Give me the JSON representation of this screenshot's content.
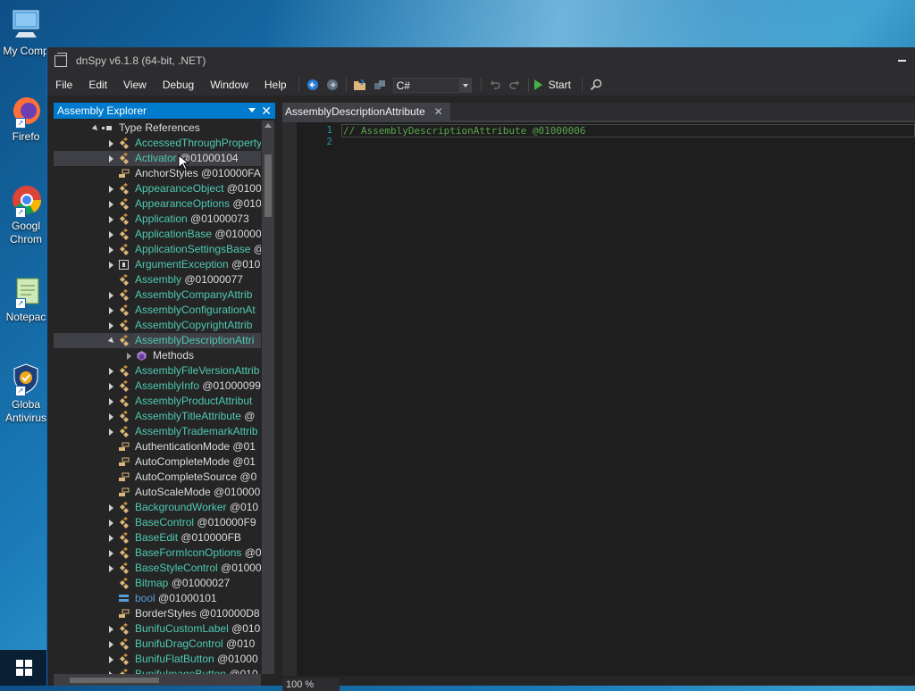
{
  "desktop": {
    "icons": [
      {
        "label": "My Comp",
        "icon": "computer-icon"
      },
      {
        "label": "Firefo",
        "icon": "firefox-icon"
      },
      {
        "label": "Googl\nChrom",
        "icon": "chrome-icon"
      },
      {
        "label": "Notepac",
        "icon": "notepad-icon"
      },
      {
        "label": "Globa\nAntivirus",
        "icon": "antivirus-icon"
      }
    ]
  },
  "window": {
    "title": "dnSpy v6.1.8 (64-bit, .NET)"
  },
  "menu": [
    "File",
    "Edit",
    "View",
    "Debug",
    "Window",
    "Help"
  ],
  "toolbar": {
    "language": "C#",
    "start_label": "Start"
  },
  "explorer": {
    "title": "Assembly Explorer",
    "items": [
      {
        "text": "Type References",
        "kind": "refs",
        "level": 0,
        "expand": "open"
      },
      {
        "text": "AccessedThroughProperty",
        "kind": "class",
        "level": 1,
        "expand": "closed"
      },
      {
        "text": "Activator",
        "suffix": " @01000104",
        "kind": "class",
        "level": 1,
        "expand": "closed",
        "selected": true
      },
      {
        "text": "AnchorStyles @010000FA",
        "kind": "enum",
        "level": 1,
        "expand": "none"
      },
      {
        "text": "AppearanceObject",
        "suffix": " @0100",
        "kind": "class",
        "level": 1,
        "expand": "closed"
      },
      {
        "text": "AppearanceOptions",
        "suffix": " @010",
        "kind": "class",
        "level": 1,
        "expand": "closed"
      },
      {
        "text": "Application",
        "suffix": " @01000073",
        "kind": "class",
        "level": 1,
        "expand": "closed"
      },
      {
        "text": "ApplicationBase",
        "suffix": " @010000",
        "kind": "class",
        "level": 1,
        "expand": "closed"
      },
      {
        "text": "ApplicationSettingsBase",
        "suffix": " @",
        "kind": "class",
        "level": 1,
        "expand": "closed"
      },
      {
        "text": "ArgumentException",
        "suffix": " @010",
        "kind": "exception",
        "level": 1,
        "expand": "closed"
      },
      {
        "text": "Assembly",
        "suffix": " @01000077",
        "kind": "class",
        "level": 1,
        "expand": "none"
      },
      {
        "text": "AssemblyCompanyAttrib",
        "kind": "class",
        "level": 1,
        "expand": "closed"
      },
      {
        "text": "AssemblyConfigurationAt",
        "kind": "class",
        "level": 1,
        "expand": "closed"
      },
      {
        "text": "AssemblyCopyrightAttrib",
        "kind": "class",
        "level": 1,
        "expand": "closed"
      },
      {
        "text": "AssemblyDescriptionAttri",
        "kind": "class",
        "level": 1,
        "expand": "open",
        "selected": true
      },
      {
        "text": "Methods",
        "kind": "methods",
        "level": 2,
        "expand": "hollow"
      },
      {
        "text": "AssemblyFileVersionAttrib",
        "kind": "class",
        "level": 1,
        "expand": "closed"
      },
      {
        "text": "AssemblyInfo",
        "suffix": " @01000099",
        "kind": "class",
        "level": 1,
        "expand": "closed"
      },
      {
        "text": "AssemblyProductAttribut",
        "kind": "class",
        "level": 1,
        "expand": "closed"
      },
      {
        "text": "AssemblyTitleAttribute",
        "suffix": " @",
        "kind": "class",
        "level": 1,
        "expand": "closed"
      },
      {
        "text": "AssemblyTrademarkAttrib",
        "kind": "class",
        "level": 1,
        "expand": "closed"
      },
      {
        "text": "AuthenticationMode @01",
        "kind": "enum",
        "level": 1,
        "expand": "none"
      },
      {
        "text": "AutoCompleteMode @01",
        "kind": "enum",
        "level": 1,
        "expand": "none"
      },
      {
        "text": "AutoCompleteSource @0",
        "kind": "enum",
        "level": 1,
        "expand": "none"
      },
      {
        "text": "AutoScaleMode @010000",
        "kind": "enum",
        "level": 1,
        "expand": "none"
      },
      {
        "text": "BackgroundWorker",
        "suffix": " @010",
        "kind": "class",
        "level": 1,
        "expand": "closed"
      },
      {
        "text": "BaseControl",
        "suffix": " @010000F9",
        "kind": "class",
        "level": 1,
        "expand": "closed"
      },
      {
        "text": "BaseEdit",
        "suffix": " @010000FB",
        "kind": "class",
        "level": 1,
        "expand": "closed"
      },
      {
        "text": "BaseFormIconOptions",
        "suffix": " @0",
        "kind": "class",
        "level": 1,
        "expand": "closed"
      },
      {
        "text": "BaseStyleControl",
        "suffix": " @01000",
        "kind": "class",
        "level": 1,
        "expand": "closed"
      },
      {
        "text": "Bitmap",
        "suffix": " @01000027",
        "kind": "class",
        "level": 1,
        "expand": "none"
      },
      {
        "text": "bool",
        "suffix": " @01000101",
        "kind": "struct",
        "level": 1,
        "expand": "none"
      },
      {
        "text": "BorderStyles @010000D8",
        "kind": "enum",
        "level": 1,
        "expand": "none"
      },
      {
        "text": "BunifuCustomLabel",
        "suffix": " @010",
        "kind": "class",
        "level": 1,
        "expand": "closed"
      },
      {
        "text": "BunifuDragControl",
        "suffix": " @010",
        "kind": "class",
        "level": 1,
        "expand": "closed"
      },
      {
        "text": "BunifuFlatButton",
        "suffix": " @01000",
        "kind": "class",
        "level": 1,
        "expand": "closed"
      },
      {
        "text": "BunifuImageButton",
        "suffix": " @010",
        "kind": "class",
        "level": 1,
        "expand": "closed"
      }
    ]
  },
  "editor": {
    "tab_label": "AssemblyDescriptionAttribute",
    "lines": [
      {
        "num": "1",
        "text": "// AssemblyDescriptionAttribute @01000006"
      },
      {
        "num": "2",
        "text": ""
      }
    ],
    "zoom": "100 %"
  },
  "colors": {
    "accent": "#007acc",
    "class": "#4ec9b0",
    "comment": "#57a64a",
    "line_number": "#2b91af"
  }
}
